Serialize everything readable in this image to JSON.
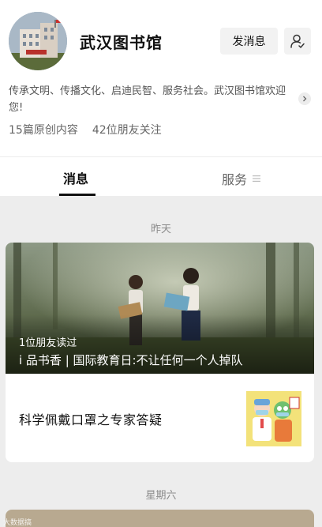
{
  "account": {
    "name": "武汉图书馆",
    "message_button": "发消息",
    "description": "传承文明、传播文化、启迪民智、服务社会。武汉图书馆欢迎您!",
    "stats": {
      "articles": "15篇原创内容",
      "friends": "42位朋友关注"
    }
  },
  "tabs": {
    "messages": "消息",
    "services": "服务"
  },
  "feed": {
    "date_1": "昨天",
    "date_2": "星期六",
    "article": {
      "friends_read": "1位朋友读过",
      "title": "i 品书香 | 国际教育日:不让任何一个人掉队",
      "sub_title": "科学佩戴口罩之专家答疑"
    },
    "watermark": "大数据搞"
  },
  "colors": {
    "background": "#ededed",
    "card": "#ffffff",
    "text_primary": "#111111",
    "text_secondary": "#666666"
  }
}
